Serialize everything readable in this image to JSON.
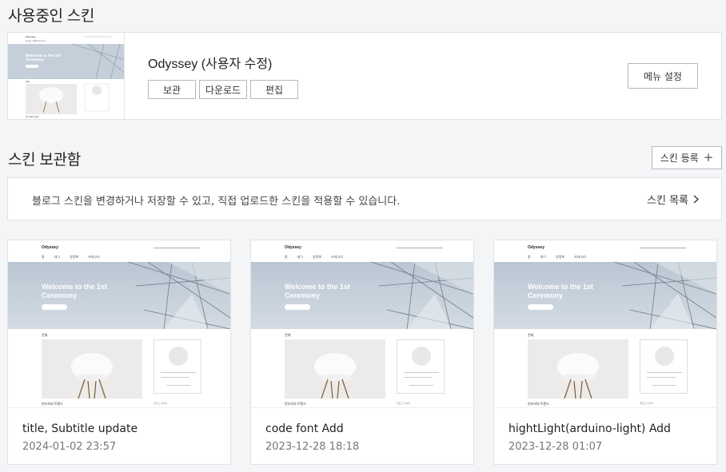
{
  "current_section": {
    "title": "사용중인 스킨",
    "skin_name": "Odyssey (사용자 수정)",
    "buttons": {
      "archive": "보관",
      "download": "다운로드",
      "edit": "편집"
    },
    "menu_settings": "메뉴 설정"
  },
  "archive_section": {
    "title": "스킨 보관함",
    "register_button": "스킨 등록",
    "info_text": "블로그 스킨을 변경하거나 저장할 수 있고, 직접 업로드한 스킨을 적용할 수 있습니다.",
    "list_link": "스킨 목록"
  },
  "preview": {
    "logo": "Odyssey",
    "hero_title_line1": "Welcome to the 1st",
    "hero_title_line2": "Ceremony",
    "nav": [
      "홈",
      "태그",
      "방명록",
      "카테고리"
    ],
    "section_label": "전체",
    "post_title": "빈티지의 트렌드",
    "side_text": "블로그 이야기"
  },
  "cards": [
    {
      "title": "title, Subtitle update",
      "date": "2024-01-02 23:57"
    },
    {
      "title": "code font Add",
      "date": "2023-12-28 18:18"
    },
    {
      "title": "hightLight(arduino-light) Add",
      "date": "2023-12-28 01:07"
    }
  ]
}
